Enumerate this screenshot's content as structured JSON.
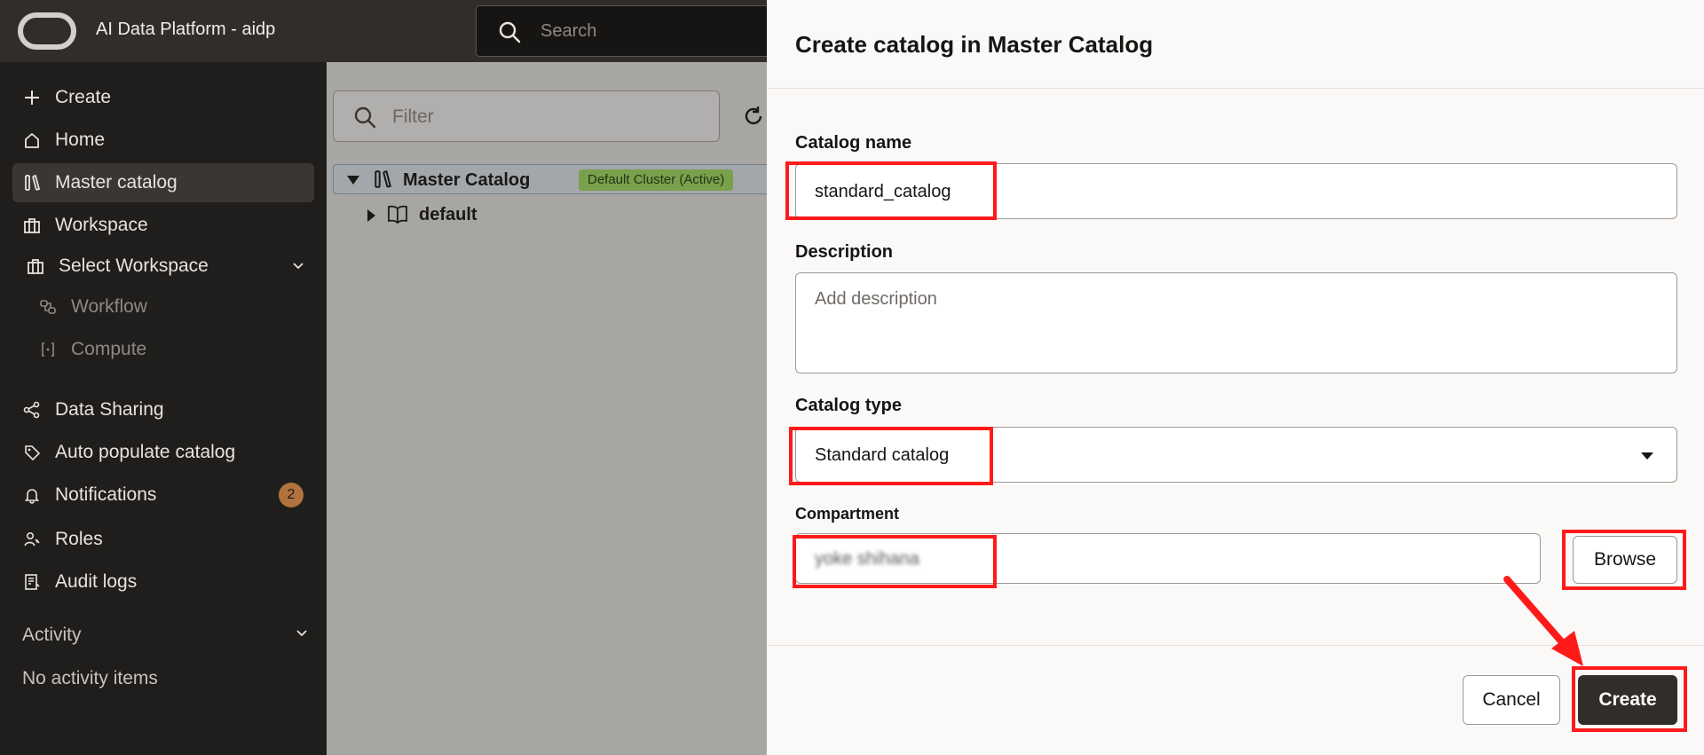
{
  "header": {
    "app_title": "AI Data Platform - aidp",
    "search_placeholder": "Search"
  },
  "sidebar": {
    "items": [
      {
        "label": "Create",
        "icon": "plus-icon"
      },
      {
        "label": "Home",
        "icon": "home-icon"
      },
      {
        "label": "Master catalog",
        "icon": "books-icon",
        "active": true
      },
      {
        "label": "Workspace",
        "icon": "workspace-icon"
      },
      {
        "label": "Select Workspace",
        "icon": "workspace-icon"
      },
      {
        "label": "Workflow",
        "icon": "workflow-icon"
      },
      {
        "label": "Compute",
        "icon": "compute-icon"
      },
      {
        "label": "Data Sharing",
        "icon": "share-icon"
      },
      {
        "label": "Auto populate catalog",
        "icon": "tag-icon"
      },
      {
        "label": "Notifications",
        "icon": "bell-icon",
        "badge": "2"
      },
      {
        "label": "Roles",
        "icon": "roles-icon"
      },
      {
        "label": "Audit logs",
        "icon": "audit-icon"
      }
    ],
    "activity_title": "Activity",
    "activity_empty": "No activity items"
  },
  "main": {
    "filter_placeholder": "Filter",
    "tree": {
      "root_label": "Master Catalog",
      "root_badge": "Default Cluster (Active)",
      "child_label": "default"
    }
  },
  "dialog": {
    "title": "Create catalog in Master Catalog",
    "catalog_name_label": "Catalog name",
    "catalog_name_value": "standard_catalog",
    "description_label": "Description",
    "description_placeholder": "Add description",
    "catalog_type_label": "Catalog type",
    "catalog_type_value": "Standard catalog",
    "compartment_label": "Compartment",
    "compartment_value": "yoke shihana",
    "browse_label": "Browse",
    "cancel_label": "Cancel",
    "create_label": "Create"
  },
  "colors": {
    "header_bg": "#312d2a",
    "sidebar_bg": "#201e1c",
    "highlight": "#ff1a1a",
    "badge": "#b1733d",
    "cluster_badge": "#79a04a"
  }
}
